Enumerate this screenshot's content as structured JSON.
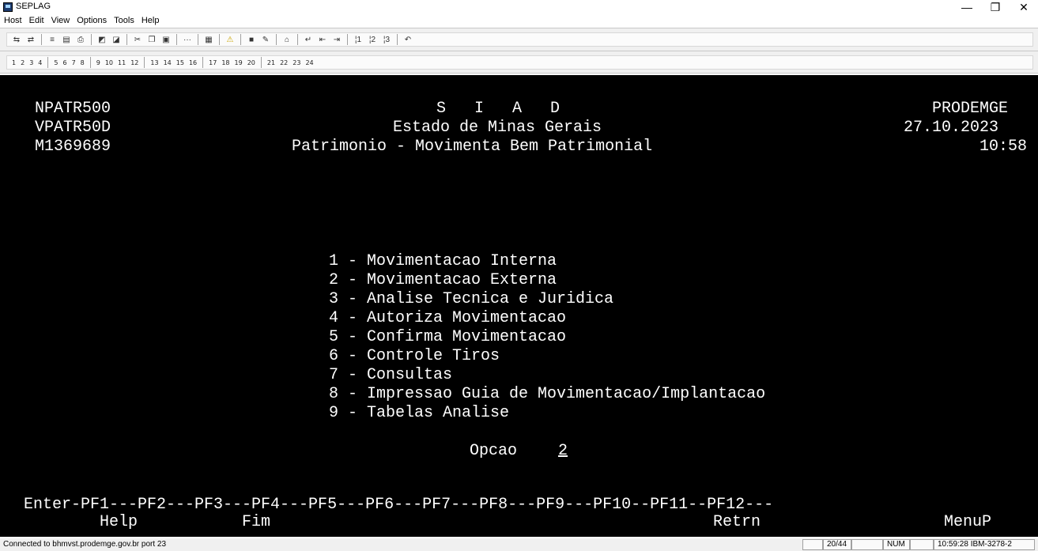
{
  "window": {
    "title": "SEPLAG",
    "controls": {
      "minimize": "—",
      "maximize": "❐",
      "close": "✕"
    }
  },
  "menu": [
    "Host",
    "Edit",
    "View",
    "Options",
    "Tools",
    "Help"
  ],
  "toolbar_icons": [
    "send-icon",
    "receive-icon",
    "transfer-icon",
    "copy-screen-icon",
    "print-icon",
    "capture-icon",
    "edit-capture-icon",
    "cut-icon",
    "copy-icon",
    "paste-icon",
    "dots-icon",
    "graph-icon",
    "alert-icon",
    "stop-icon",
    "pen-icon",
    "home-icon",
    "enter-icon",
    "backtab-icon",
    "tab-icon",
    "pa1-icon",
    "pa2-icon",
    "pa3-icon",
    "undo-icon"
  ],
  "pf_keys": [
    "1",
    "2",
    "3",
    "4",
    "5",
    "6",
    "7",
    "8",
    "9",
    "10",
    "11",
    "12",
    "13",
    "14",
    "15",
    "16",
    "17",
    "18",
    "19",
    "20",
    "21",
    "22",
    "23",
    "24"
  ],
  "terminal": {
    "header": {
      "program": "NPATR500",
      "screen_id": "VPATR50D",
      "user": "M1369689",
      "system": "S   I   A   D",
      "state": "Estado de Minas Gerais",
      "module": "Patrimonio - Movimenta Bem Patrimonial",
      "company": "PRODEMGE",
      "date": "27.10.2023",
      "time": "10:58"
    },
    "menu_items": [
      "1 - Movimentacao Interna",
      "2 - Movimentacao Externa",
      "3 - Analise Tecnica e Juridica",
      "4 - Autoriza Movimentacao",
      "5 - Confirma Movimentacao",
      "6 - Controle Tiros",
      "7 - Consultas",
      "8 - Impressao Guia de Movimentacao/Implantacao",
      "9 - Tabelas Analise"
    ],
    "option_label": "Opcao",
    "option_value": "2",
    "pf_line": "Enter-PF1---PF2---PF3---PF4---PF5---PF6---PF7---PF8---PF9---PF10--PF11--PF12---",
    "pf_help": "Help",
    "pf_fim": "Fim",
    "pf_retrn": "Retrn",
    "pf_menup": "MenuP"
  },
  "status": {
    "connection": "Connected to bhmvst.prodemge.gov.br port 23",
    "cursor": "20/44",
    "num": "NUM",
    "clock_session": "10:59:28 IBM-3278-2"
  }
}
